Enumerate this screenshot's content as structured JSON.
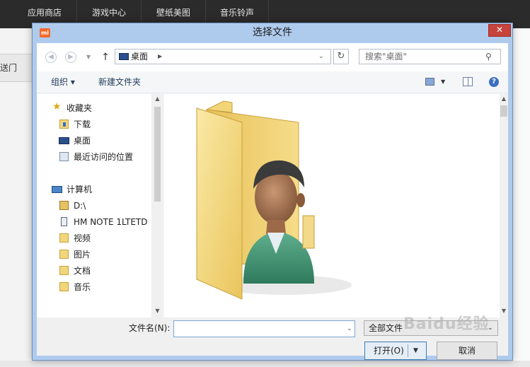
{
  "topnav": {
    "items": [
      "应用商店",
      "游戏中心",
      "壁纸美图",
      "音乐铃声"
    ]
  },
  "bg_sidebar": {
    "label": "传送门"
  },
  "dialog": {
    "logo": "mi",
    "title": "选择文件",
    "close": "✕",
    "address": {
      "location": "桌面"
    },
    "search": {
      "placeholder": "搜索\"桌面\""
    },
    "toolbar": {
      "organize": "组织 ▾",
      "new_folder": "新建文件夹",
      "help": "?"
    },
    "nav": {
      "favorites_header": "收藏夹",
      "favorites": [
        "下载",
        "桌面",
        "最近访问的位置"
      ],
      "computer_header": "计算机",
      "computer_items": [
        "D:\\",
        "HM NOTE 1LTETD",
        "视频",
        "图片",
        "文档",
        "音乐"
      ]
    },
    "filename_label": "文件名(N):",
    "filename_value": "",
    "filetype": "全部文件",
    "open_label": "打开(O)",
    "cancel_label": "取消"
  },
  "watermark": "Baidu经验",
  "colors": {
    "title_bar": "#aecbee",
    "close": "#c7433c",
    "topnav": "#2b2b2b",
    "accent": "#3c7fb1"
  }
}
